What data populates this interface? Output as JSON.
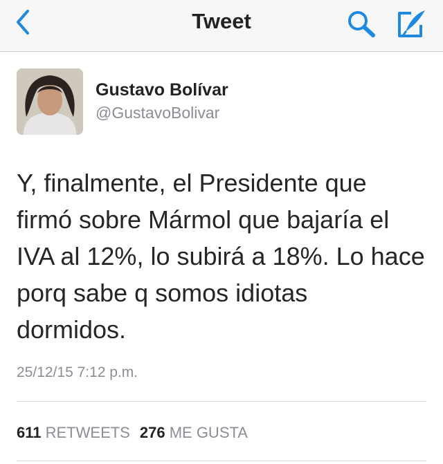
{
  "navbar": {
    "title": "Tweet",
    "back_icon": "chevron-left-icon",
    "search_icon": "search-icon",
    "compose_icon": "compose-tweet-icon",
    "accent_color": "#1d8ae0"
  },
  "tweet": {
    "author_name": "Gustavo Bolívar",
    "author_handle": "@GustavoBolivar",
    "text": "Y, finalmente, el Presidente que\nfirmó sobre Mármol que bajaría el\nIVA al 12%, lo subirá a 18%. Lo hace\nporq sabe q somos idiotas\ndormidos.",
    "timestamp": "25/12/15 7:12 p.m."
  },
  "stats": {
    "retweets_count": "611",
    "retweets_label": "RETWEETS",
    "likes_count": "276",
    "likes_label": "ME GUSTA"
  }
}
